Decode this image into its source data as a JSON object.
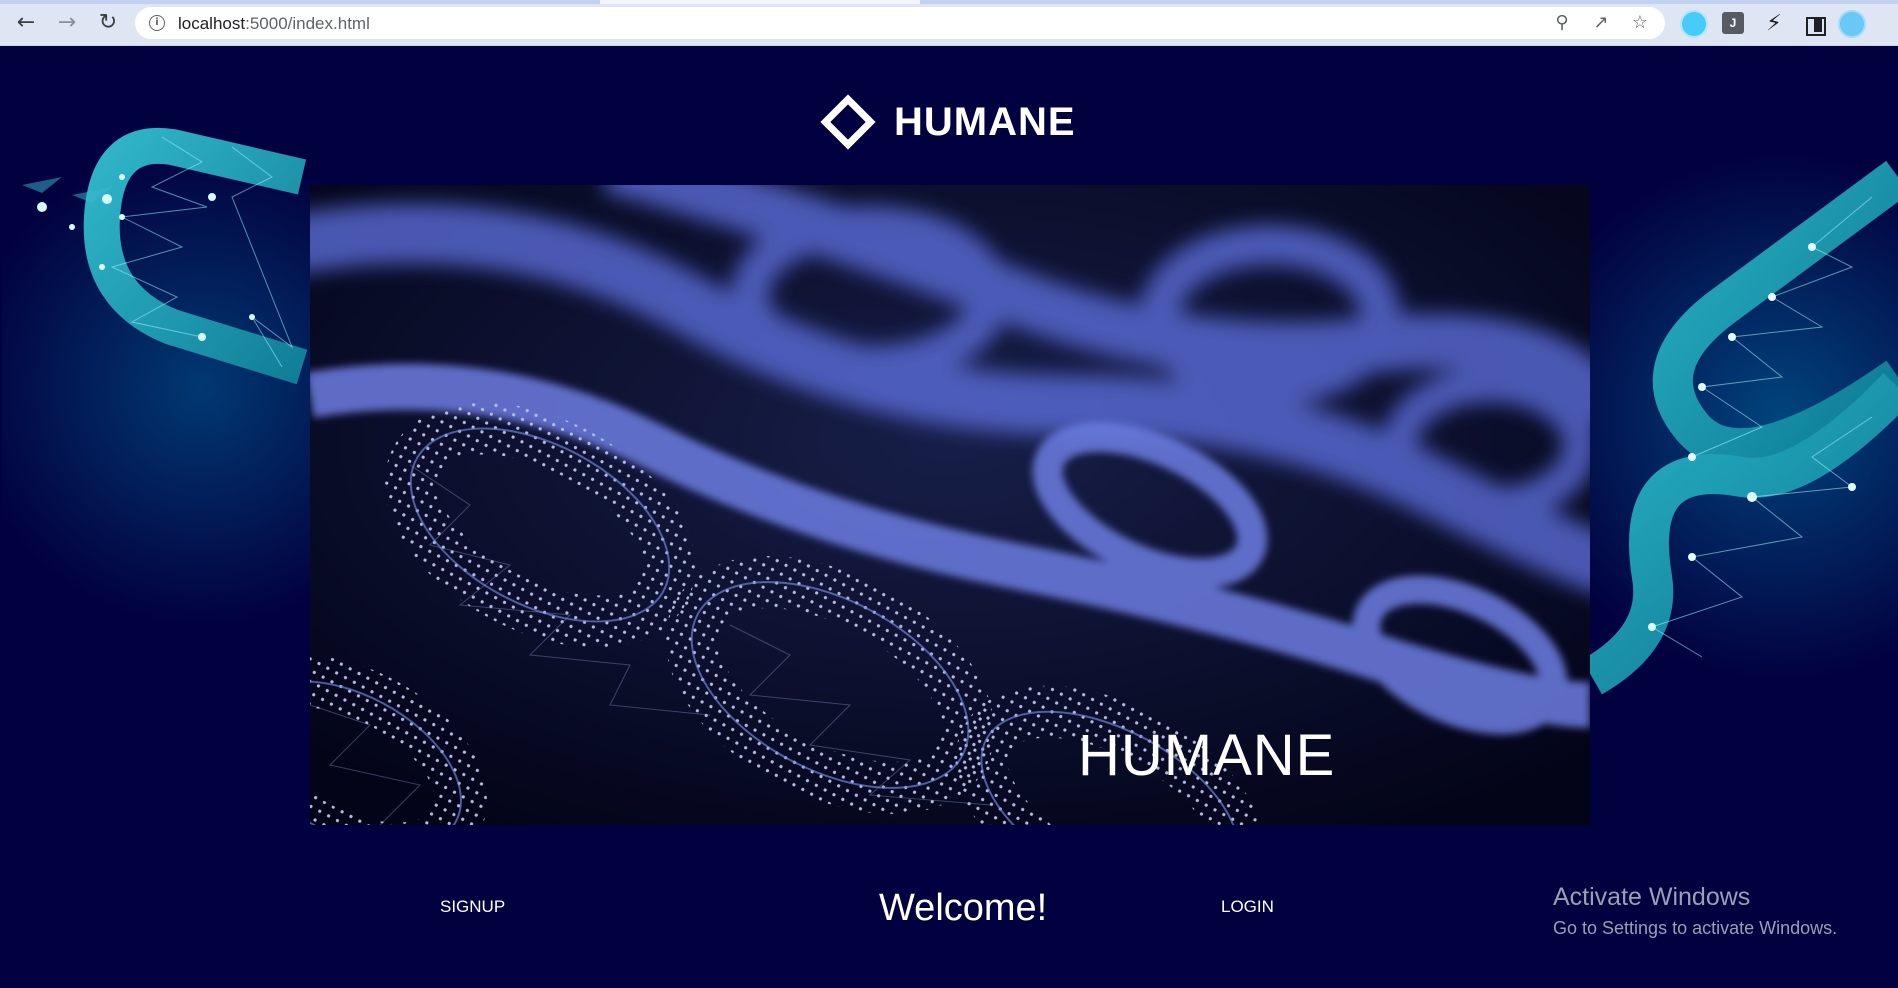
{
  "browser": {
    "url_host": "localhost",
    "url_path": ":5000/index.html",
    "icons": {
      "back": "arrow-left",
      "forward": "arrow-right",
      "reload": "reload",
      "site_info": "info",
      "zoom": "magnifier",
      "share": "share",
      "bookmark": "star",
      "extension": "J",
      "extensions_menu": "puzzle",
      "side_panel": "side-panel",
      "profile": "avatar"
    }
  },
  "header": {
    "brand_name": "HUMANE"
  },
  "hero": {
    "title": "HUMANE"
  },
  "footer": {
    "signup_label": "SIGNUP",
    "welcome_text": "Welcome!",
    "login_label": "LOGIN"
  },
  "watermark": {
    "title": "Activate Windows",
    "subtitle": "Go to Settings to activate Windows."
  },
  "colors": {
    "page_background": "#02013f",
    "chain_left_right": "#2fb8c8",
    "chain_hero": "#6f86ff"
  }
}
